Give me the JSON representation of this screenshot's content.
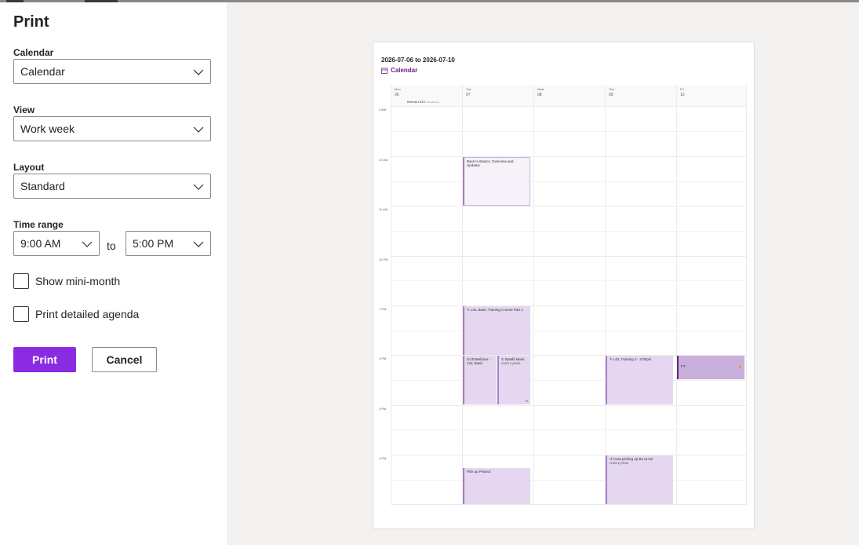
{
  "panel": {
    "title": "Print",
    "calendar_label": "Calendar",
    "calendar_value": "Calendar",
    "view_label": "View",
    "view_value": "Work week",
    "layout_label": "Layout",
    "layout_value": "Standard",
    "time_range_label": "Time range",
    "time_from": "9:00 AM",
    "to_label": "to",
    "time_to": "5:00 PM",
    "show_mini_month": "Show mini-month",
    "print_detailed_agenda": "Print detailed agenda",
    "print_button": "Print",
    "cancel_button": "Cancel"
  },
  "preview": {
    "date_range": "2026-07-06 to 2026-07-10",
    "calendar_name": "Calendar",
    "days": [
      {
        "name": "Mon",
        "num": "06"
      },
      {
        "name": "Tue",
        "num": "07"
      },
      {
        "name": "Wed",
        "num": "08"
      },
      {
        "name": "Thu",
        "num": "09"
      },
      {
        "name": "Fri",
        "num": "10"
      }
    ],
    "all_day_event": {
      "title": "Brenda OOO",
      "sub": "Brenda Ann"
    },
    "hours": [
      "9 AM",
      "10 AM",
      "11 AM",
      "12 PM",
      "1 PM",
      "2 PM",
      "3 PM",
      "4 PM"
    ],
    "events": {
      "e1": {
        "title": "Back to Basics: Overview and Updates"
      },
      "e2": {
        "title": "✎ LGL Basic Training Course Part 1"
      },
      "e3": {
        "title": "GoToWebinar - LGL Basic"
      },
      "e4": {
        "title": "↻ Batelli Meeti",
        "sub": "Cara Lyman",
        "corner": "⊡"
      },
      "e5": {
        "title": "✎ LGL Training 2 - 3:00pm"
      },
      "e6": {
        "title": "PT",
        "corner": "🔒"
      },
      "e7": {
        "title": "Pick up Peanut"
      },
      "e8": {
        "title": "↺ Cara picking up Bo at vet",
        "sub": "Cara Lyman"
      }
    }
  },
  "colors": {
    "accent": "#8a2be2",
    "calendar_purple": "#6b1f8a",
    "event_fill": "#e4d7ef"
  }
}
